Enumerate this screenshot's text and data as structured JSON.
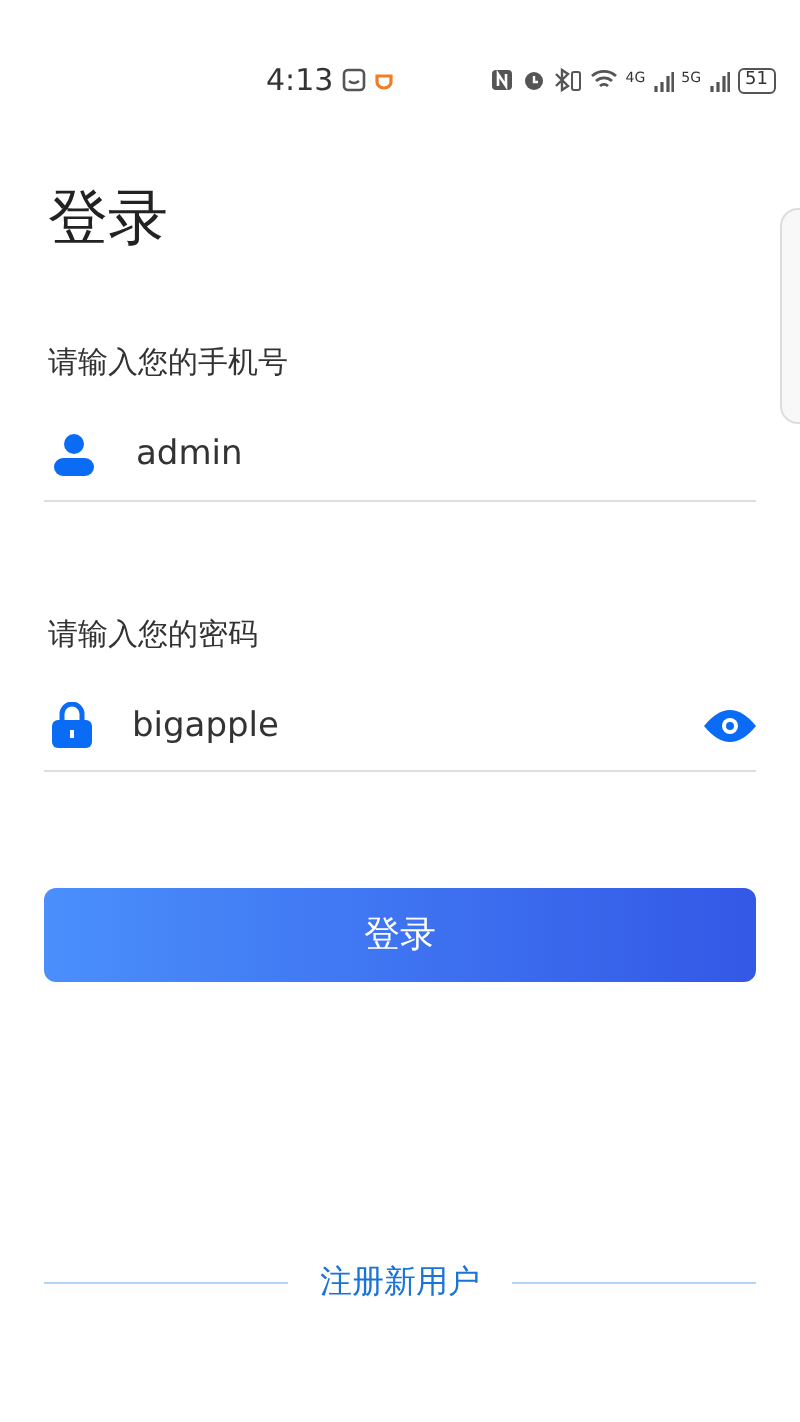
{
  "status_bar": {
    "time": "4:13",
    "network_1": "4G",
    "network_2": "5G",
    "battery": "51"
  },
  "title": "登录",
  "fields": [
    {
      "kind": "phone",
      "label": "请输入您的手机号",
      "value": "admin"
    },
    {
      "kind": "password",
      "label": "请输入您的密码",
      "value": "bigapple",
      "password_visible": true
    }
  ],
  "login_button": "登录",
  "register_link": "注册新用户"
}
